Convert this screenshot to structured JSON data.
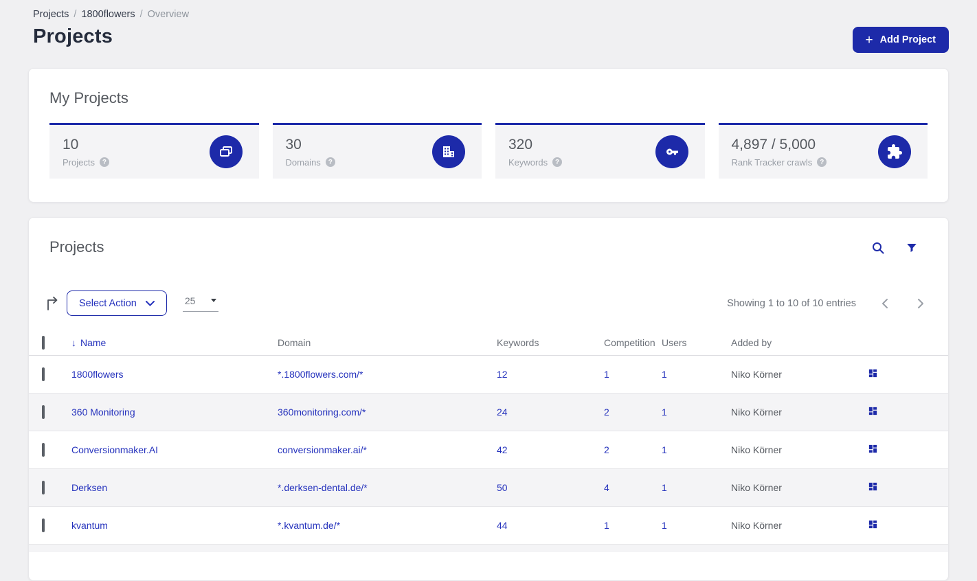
{
  "colors": {
    "brand_blue": "#1d2aa9",
    "link_blue": "#2633bd",
    "page_bg": "#f0f0f2",
    "stat_bg": "#f4f4f6"
  },
  "breadcrumb": {
    "items": [
      "Projects",
      "1800flowers",
      "Overview"
    ],
    "separator": "/"
  },
  "header": {
    "title": "Projects",
    "add_button_label": "Add Project",
    "add_button_plus": "+"
  },
  "my_projects": {
    "title": "My Projects",
    "help_glyph": "?",
    "stats": [
      {
        "value": "10",
        "label": "Projects"
      },
      {
        "value": "30",
        "label": "Domains"
      },
      {
        "value": "320",
        "label": "Keywords"
      },
      {
        "value": "4,897 / 5,000",
        "label": "Rank Tracker crawls"
      }
    ]
  },
  "projects_table": {
    "title": "Projects",
    "select_action_label": "Select Action",
    "page_size": "25",
    "showing_text": "Showing 1 to 10 of 10 entries",
    "sort_icon": "↓",
    "columns": [
      "Name",
      "Domain",
      "Keywords",
      "Competition",
      "Users",
      "Added by"
    ],
    "rows": [
      {
        "name": "1800flowers",
        "domain": "*.1800flowers.com/*",
        "keywords": "12",
        "competition": "1",
        "users": "1",
        "added_by": "Niko Körner"
      },
      {
        "name": "360 Monitoring",
        "domain": "360monitoring.com/*",
        "keywords": "24",
        "competition": "2",
        "users": "1",
        "added_by": "Niko Körner"
      },
      {
        "name": "Conversionmaker.AI",
        "domain": "conversionmaker.ai/*",
        "keywords": "42",
        "competition": "2",
        "users": "1",
        "added_by": "Niko Körner"
      },
      {
        "name": "Derksen",
        "domain": "*.derksen-dental.de/*",
        "keywords": "50",
        "competition": "4",
        "users": "1",
        "added_by": "Niko Körner"
      },
      {
        "name": "kvantum",
        "domain": "*.kvantum.de/*",
        "keywords": "44",
        "competition": "1",
        "users": "1",
        "added_by": "Niko Körner"
      }
    ]
  }
}
